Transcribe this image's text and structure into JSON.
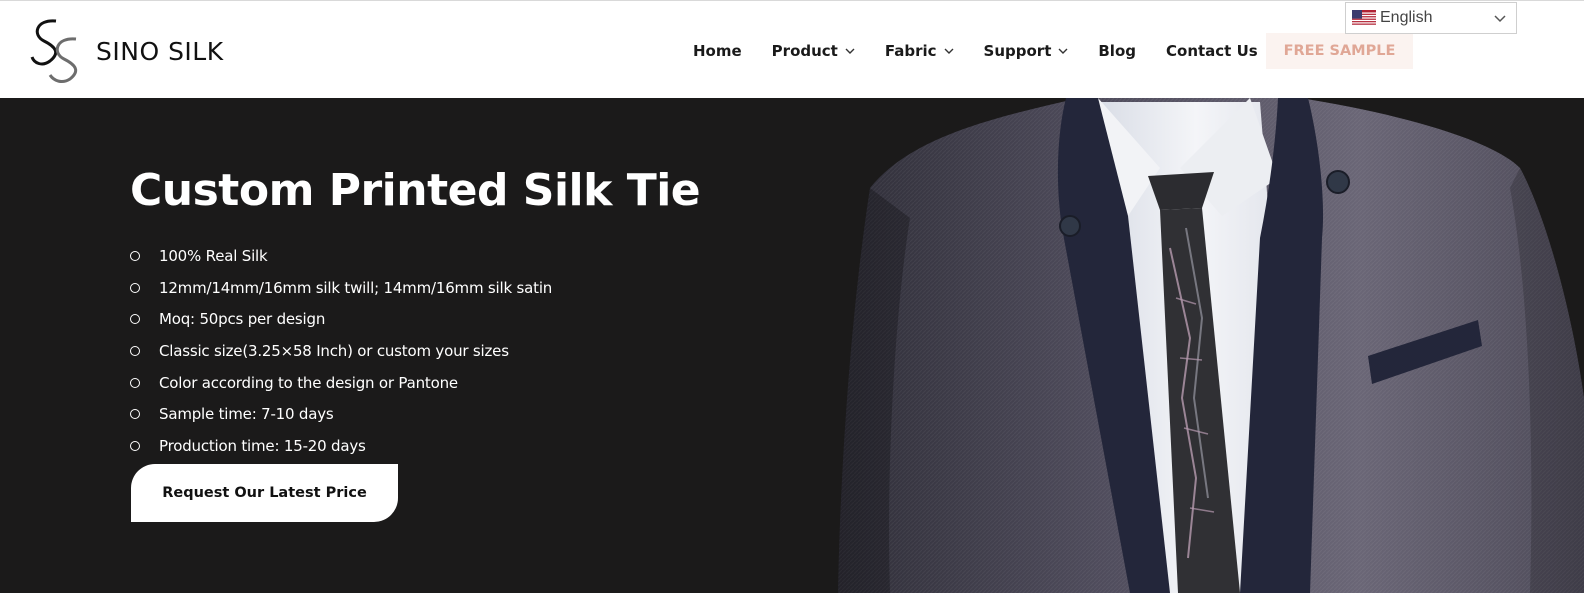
{
  "header": {
    "logo": {
      "brand": "SINO SILK"
    },
    "nav": [
      {
        "label": "Home",
        "has_dropdown": false
      },
      {
        "label": "Product",
        "has_dropdown": true
      },
      {
        "label": "Fabric",
        "has_dropdown": true
      },
      {
        "label": "Support",
        "has_dropdown": true
      },
      {
        "label": "Blog",
        "has_dropdown": false
      },
      {
        "label": "Contact Us",
        "has_dropdown": false
      }
    ],
    "cta_label": "FREE SAMPLE",
    "language": {
      "selected": "English",
      "flag_icon": "us-flag-icon"
    }
  },
  "hero": {
    "title": "Custom Printed Silk Tie",
    "features": [
      "100% Real Silk",
      "12mm/14mm/16mm silk twill; 14mm/16mm silk satin",
      "Moq: 50pcs per design",
      "Classic size(3.25×58 Inch) or custom your sizes",
      "Color according to the design or Pantone",
      "Sample time: 7-10 days",
      "Production time: 15-20 days"
    ],
    "button_label": "Request Our Latest Price",
    "image_icon": "man-in-suit-with-tie-photo"
  },
  "colors": {
    "hero_bg": "#1b1a1a",
    "accent": "#e0a796",
    "accent_bg": "#fbf3f0",
    "text_dark": "#1a1a1a"
  }
}
